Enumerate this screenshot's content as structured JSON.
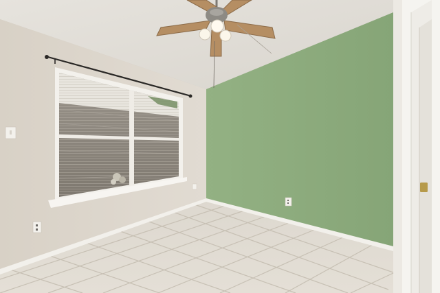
{
  "scene": {
    "subject": "empty-room-photo",
    "colors": {
      "ceiling": "#e7e4de",
      "left_wall": "#ddd6cc",
      "accent_wall": "#8fae7e",
      "accent_wall_shadow": "#83a274",
      "floor_tile": "#dcd6cc",
      "grout": "#c4bdb1",
      "baseboard": "#f3f1ec",
      "window_trim": "#f4f2ee",
      "blinds": "#e9e6df",
      "brick": "#8d8880",
      "fan_blade": "#b58e63",
      "fan_metal": "#7d7a74",
      "door_trim": "#f6f5f2",
      "curtain_rod": "#2a2826",
      "door_knob": "#b69a4a"
    }
  }
}
